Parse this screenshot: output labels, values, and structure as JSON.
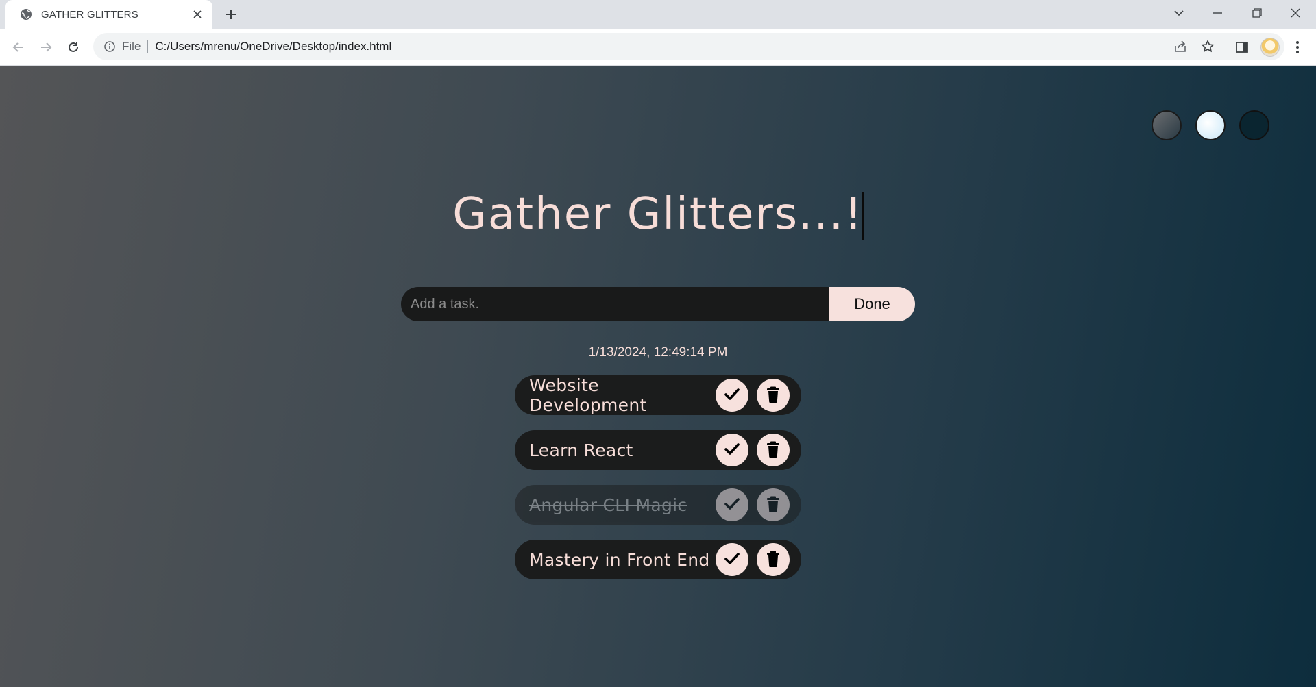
{
  "browser": {
    "tab_title": "GATHER GLITTERS",
    "url_scheme": "File",
    "url": "C:/Users/mrenu/OneDrive/Desktop/index.html"
  },
  "app": {
    "heading": "Gather Glitters...!",
    "input_placeholder": "Add a task.",
    "submit_label": "Done",
    "datetime": "1/13/2024, 12:49:14 PM",
    "themes": [
      "standard",
      "light",
      "darker"
    ],
    "todos": [
      {
        "text": "Website Development",
        "completed": false
      },
      {
        "text": "Learn React",
        "completed": false
      },
      {
        "text": "Angular CLI Magic",
        "completed": true
      },
      {
        "text": "Mastery in Front End",
        "completed": false
      }
    ]
  },
  "colors": {
    "accent": "#f7e1dd",
    "text": "#f7ddd8",
    "item_bg": "#1b1c1c"
  },
  "icons": {
    "check": "check-icon",
    "trash": "trash-icon",
    "globe": "globe-icon"
  }
}
